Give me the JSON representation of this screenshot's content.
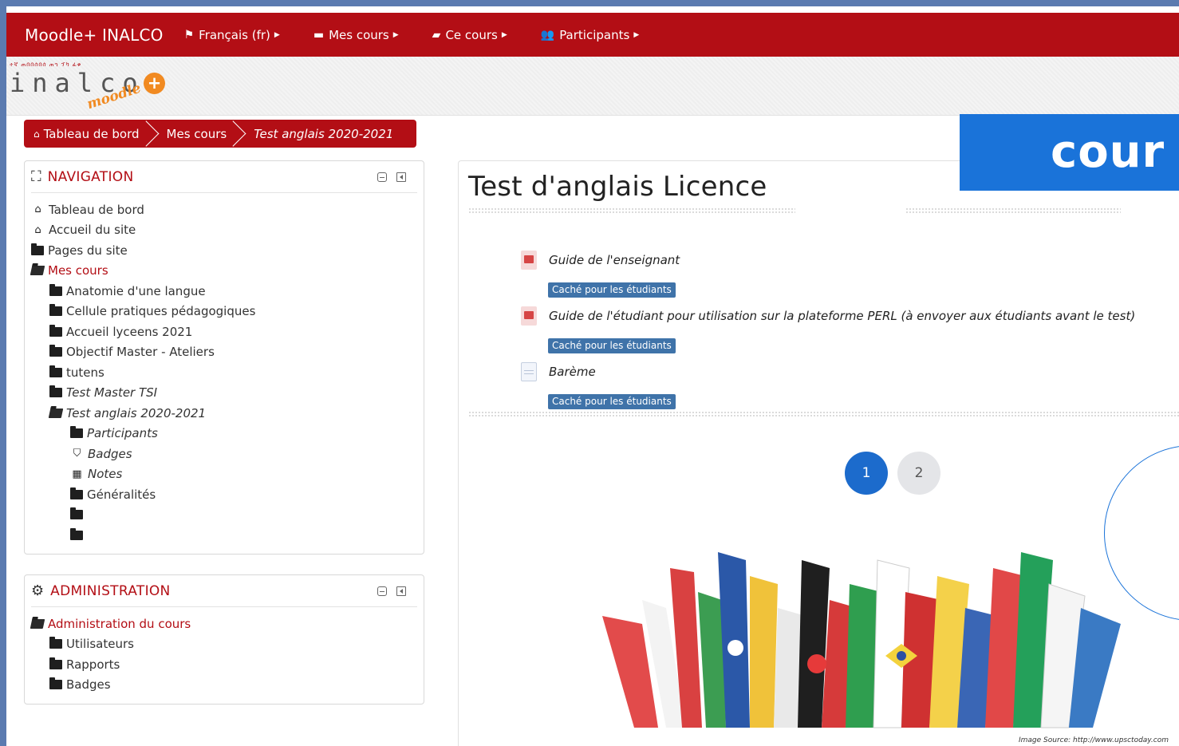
{
  "navbar": {
    "brand": "Moodle+ INALCO",
    "menus": [
      {
        "label": "Français (fr)",
        "icon": "flag-icon"
      },
      {
        "label": "Mes cours",
        "icon": "briefcase-icon"
      },
      {
        "label": "Ce cours",
        "icon": "book-icon"
      },
      {
        "label": "Participants",
        "icon": "users-icon"
      }
    ],
    "background": "#b30e15"
  },
  "logo": {
    "text": "inalco",
    "sub": "moodle",
    "plus": "+"
  },
  "breadcrumb": {
    "items": [
      "Tableau de bord",
      "Mes cours",
      "Test anglais 2020-2021"
    ]
  },
  "navigation_block": {
    "title": "NAVIGATION",
    "items": [
      {
        "label": "Tableau de bord",
        "level": 1,
        "icon": "home-icon"
      },
      {
        "label": "Accueil du site",
        "level": 1,
        "icon": "home-icon"
      },
      {
        "label": "Pages du site",
        "level": 1,
        "icon": "folder-icon"
      },
      {
        "label": "Mes cours",
        "level": 1,
        "icon": "folder-open-icon",
        "active": true
      },
      {
        "label": "Anatomie d'une langue",
        "level": 2,
        "icon": "folder-icon"
      },
      {
        "label": "Cellule pratiques pédagogiques",
        "level": 2,
        "icon": "folder-icon"
      },
      {
        "label": "Accueil lyceens 2021",
        "level": 2,
        "icon": "folder-icon"
      },
      {
        "label": "Objectif Master - Ateliers",
        "level": 2,
        "icon": "folder-icon"
      },
      {
        "label": "tutens",
        "level": 2,
        "icon": "folder-icon"
      },
      {
        "label": "Test Master TSI",
        "level": 2,
        "icon": "folder-icon",
        "italic": true
      },
      {
        "label": "Test anglais 2020-2021",
        "level": 2,
        "icon": "folder-open-icon",
        "italic": true
      },
      {
        "label": "Participants",
        "level": 3,
        "icon": "folder-icon",
        "italic": true
      },
      {
        "label": "Badges",
        "level": 3,
        "icon": "shield-icon",
        "italic": true
      },
      {
        "label": "Notes",
        "level": 3,
        "icon": "table-icon",
        "italic": true
      },
      {
        "label": "Généralités",
        "level": 3,
        "icon": "folder-icon"
      },
      {
        "label": "",
        "level": 3,
        "icon": "folder-icon"
      },
      {
        "label": "",
        "level": 3,
        "icon": "folder-icon"
      }
    ]
  },
  "administration_block": {
    "title": "ADMINISTRATION",
    "items": [
      {
        "label": "Administration du cours",
        "level": 1,
        "icon": "folder-open-icon",
        "active": true
      },
      {
        "label": "Utilisateurs",
        "level": 2,
        "icon": "folder-icon"
      },
      {
        "label": "Rapports",
        "level": 2,
        "icon": "folder-icon"
      },
      {
        "label": "Badges",
        "level": 2,
        "icon": "folder-icon"
      }
    ]
  },
  "course": {
    "title": "Test d'anglais Licence",
    "activities": [
      {
        "name": "Guide de l'enseignant",
        "icon": "pdf-icon",
        "badge": "Caché pour les étudiants"
      },
      {
        "name": "Guide de l'étudiant pour utilisation sur la plateforme PERL (à envoyer aux étudiants avant le test)",
        "icon": "pdf-icon",
        "badge": "Caché pour les étudiants"
      },
      {
        "name": "Barème",
        "icon": "document-icon",
        "badge": "Caché pour les étudiants"
      }
    ],
    "pagination": {
      "pages": [
        "1",
        "2"
      ],
      "current": "1"
    },
    "image_source": "Image Source: http://www.upsctoday.com"
  },
  "overlay": {
    "banner_text": "cour",
    "accent": "#1a73d9"
  }
}
